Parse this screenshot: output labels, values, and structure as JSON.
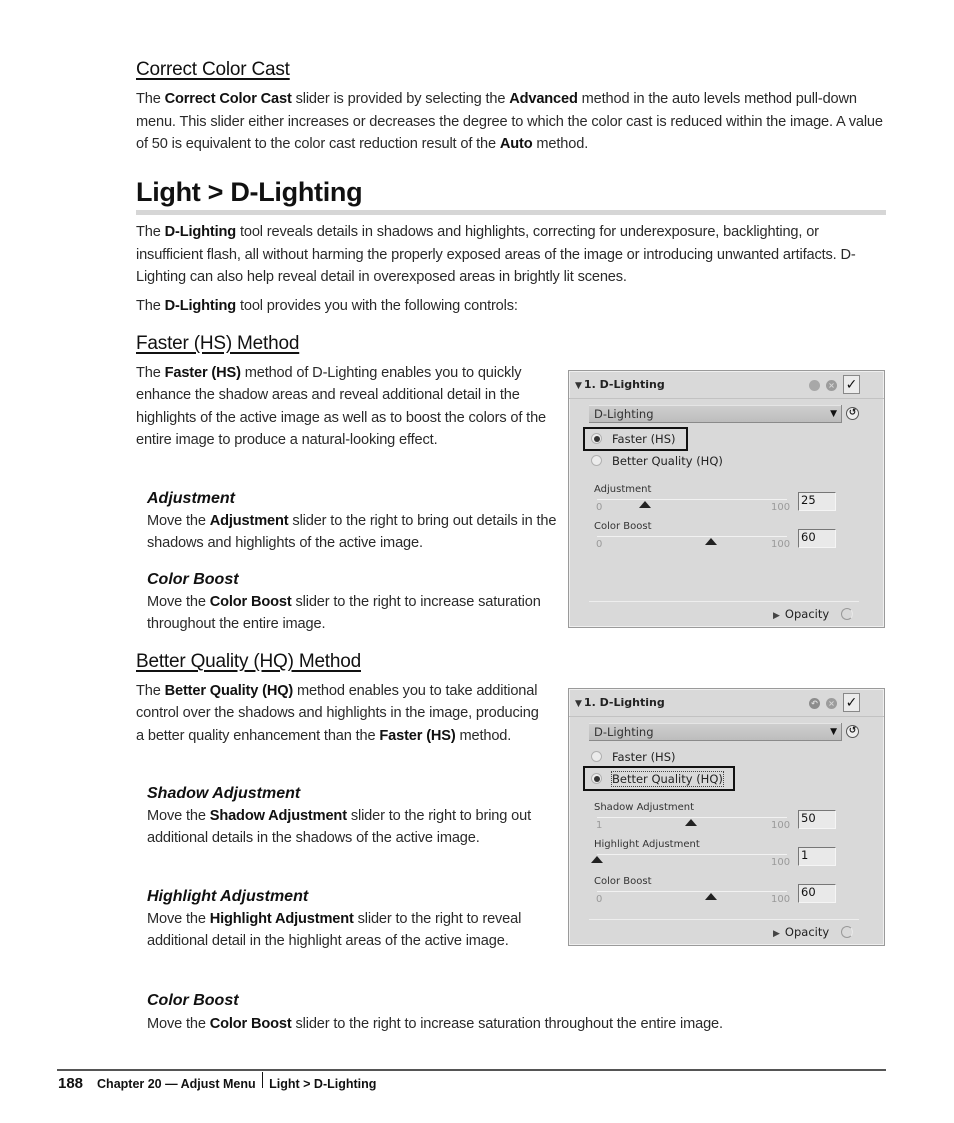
{
  "correct_color_cast": {
    "heading": "Correct Color Cast",
    "para": {
      "t1": "The ",
      "b1": "Correct Color Cast",
      "t2": " slider is provided by selecting the ",
      "b2": "Advanced",
      "t3": " method in the auto levels method pull-down menu. This slider either increases or decreases the degree to which the color cast is reduced within the image. A value of 50 is equivalent to the color cast reduction result of the ",
      "b3": "Auto",
      "t4": " method."
    }
  },
  "d_lighting": {
    "heading": "Light > D-Lighting",
    "para1": {
      "t1": "The ",
      "b1": "D-Lighting",
      "t2": " tool reveals details in shadows and highlights, correcting for underexposure, backlighting, or insufficient flash, all without harming the properly exposed areas of the image or introducing unwanted artifacts. D-Lighting can also help reveal detail in overexposed areas in brightly lit scenes."
    },
    "para2": {
      "t1": "The ",
      "b1": "D-Lighting",
      "t2": " tool provides you with the following controls:"
    }
  },
  "faster_method": {
    "heading": "Faster (HS) Method",
    "para": {
      "t1": "The ",
      "b1": "Faster (HS)",
      "t2": " method of D-Lighting enables you to quickly enhance the shadow areas and reveal additional detail in the highlights of the active image as well as to boost the colors of the entire image to produce a natural-looking effect."
    },
    "adjustment": {
      "heading": "Adjustment",
      "t1": "Move the ",
      "b1": "Adjustment",
      "t2": " slider to the right to bring out details in the shadows and highlights of the active image."
    },
    "color_boost": {
      "heading": "Color Boost",
      "t1": "Move the ",
      "b1": "Color Boost",
      "t2": " slider to the right to increase saturation throughout the entire image."
    }
  },
  "better_method": {
    "heading": "Better Quality (HQ) Method",
    "para": {
      "t1": "The ",
      "b1": "Better Quality (HQ)",
      "t2": " method enables you to take additional control over the shadows and highlights in the image, producing a better quality enhancement than the ",
      "b2": "Faster (HS)",
      "t3": " method."
    },
    "shadow": {
      "heading": "Shadow Adjustment",
      "t1": "Move the ",
      "b1": "Shadow Adjustment",
      "t2": " slider to the right to bring out additional details in the shadows of the active image."
    },
    "highlight": {
      "heading": "Highlight Adjustment",
      "t1": "Move the ",
      "b1": "Highlight Adjustment",
      "t2": " slider to the right to reveal additional detail in the highlight areas of the active image."
    },
    "color_boost": {
      "heading": "Color Boost",
      "t1": "Move the ",
      "b1": "Color Boost",
      "t2": " slider to the right to increase saturation throughout the entire image."
    }
  },
  "panel_hs": {
    "title": "1. D-Lighting",
    "expand_glyph": "▼",
    "check_glyph": "✓",
    "x_glyph": "×",
    "dropdown_value": "D-Lighting",
    "dropdown_arrow": "▼",
    "reset_glyph": "↺",
    "radios": [
      {
        "label": "Faster (HS)",
        "selected": true
      },
      {
        "label": "Better Quality (HQ)",
        "selected": false
      }
    ],
    "sliders": [
      {
        "label": "Adjustment",
        "min": 0,
        "max": 100,
        "value": 25
      },
      {
        "label": "Color Boost",
        "min": 0,
        "max": 100,
        "value": 60
      }
    ],
    "opacity_label": "Opacity",
    "opacity_glyph": "▶"
  },
  "panel_hq": {
    "title": "1. D-Lighting",
    "expand_glyph": "▼",
    "check_glyph": "✓",
    "x_glyph": "×",
    "undo_glyph": "↶",
    "dropdown_value": "D-Lighting",
    "dropdown_arrow": "▼",
    "reset_glyph": "↺",
    "radios": [
      {
        "label": "Faster (HS)",
        "selected": false
      },
      {
        "label": "Better Quality (HQ)",
        "selected": true
      }
    ],
    "sliders": [
      {
        "label": "Shadow Adjustment",
        "min": 1,
        "max": 100,
        "value": 50
      },
      {
        "label": "Highlight Adjustment",
        "min": 1,
        "max": 100,
        "value": 1
      },
      {
        "label": "Color Boost",
        "min": 0,
        "max": 100,
        "value": 60
      }
    ],
    "opacity_label": "Opacity",
    "opacity_glyph": "▶"
  },
  "footer": {
    "page_number": "188",
    "chapter": "Chapter 20 — Adjust Menu",
    "section": "Light > D-Lighting"
  }
}
